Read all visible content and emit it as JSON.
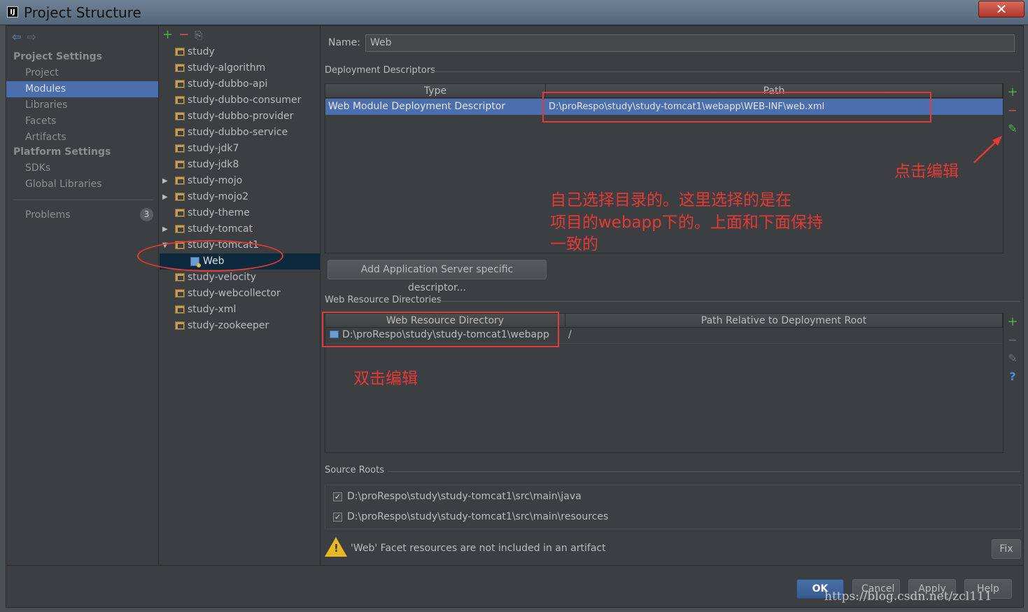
{
  "window": {
    "title": "Project Structure",
    "close_label": "✕"
  },
  "nav": {
    "project_settings_header": "Project Settings",
    "platform_settings_header": "Platform Settings",
    "items": [
      "Project",
      "Modules",
      "Libraries",
      "Facets",
      "Artifacts"
    ],
    "platform_items": [
      "SDKs",
      "Global Libraries"
    ],
    "problems_label": "Problems",
    "problems_count": "3",
    "selected": "Modules"
  },
  "tree": {
    "modules": [
      "study",
      "study-algorithm",
      "study-dubbo-api",
      "study-dubbo-consumer",
      "study-dubbo-provider",
      "study-dubbo-service",
      "study-jdk7",
      "study-jdk8",
      "study-mojo",
      "study-mojo2",
      "study-theme",
      "study-tomcat",
      "study-tomcat1",
      "Web",
      "study-velocity",
      "study-webcollector",
      "study-xml",
      "study-zookeeper"
    ],
    "selected": "Web"
  },
  "facet": {
    "name_label": "Name:",
    "name_value": "Web",
    "deployment_descriptors_title": "Deployment Descriptors",
    "dd_columns": [
      "Type",
      "Path"
    ],
    "dd_rows": [
      {
        "type": "Web Module Deployment Descriptor",
        "path": "D:\\proRespo\\study\\study-tomcat1\\webapp\\WEB-INF\\web.xml"
      }
    ],
    "add_server_descriptor_button": "Add Application Server specific descriptor...",
    "web_resource_dirs_title": "Web Resource Directories",
    "wrd_columns": [
      "Web Resource Directory",
      "Path Relative to Deployment Root"
    ],
    "wrd_rows": [
      {
        "dir": "D:\\proRespo\\study\\study-tomcat1\\webapp",
        "relative": "/"
      }
    ],
    "source_roots_title": "Source Roots",
    "source_roots": [
      {
        "path": "D:\\proRespo\\study\\study-tomcat1\\src\\main\\java",
        "checked": true
      },
      {
        "path": "D:\\proRespo\\study\\study-tomcat1\\src\\main\\resources",
        "checked": true
      }
    ],
    "warning_text": "'Web' Facet resources are not included in an artifact",
    "fix_button": "Fix"
  },
  "buttons": {
    "ok": "OK",
    "cancel": "Cancel",
    "apply": "Apply",
    "help": "Help"
  },
  "annotations": {
    "click_edit": "点击编辑",
    "explain_line1": "自己选择目录的。这里选择的是在",
    "explain_line2": "项目的webapp下的。上面和下面保持",
    "explain_line3": "一致的",
    "double_click_edit": "双击编辑"
  },
  "watermark": "https://blog.csdn.net/zcl111",
  "colors": {
    "selection": "#4b6eaf",
    "annotation_red": "#e53935",
    "background": "#3c3f41"
  }
}
